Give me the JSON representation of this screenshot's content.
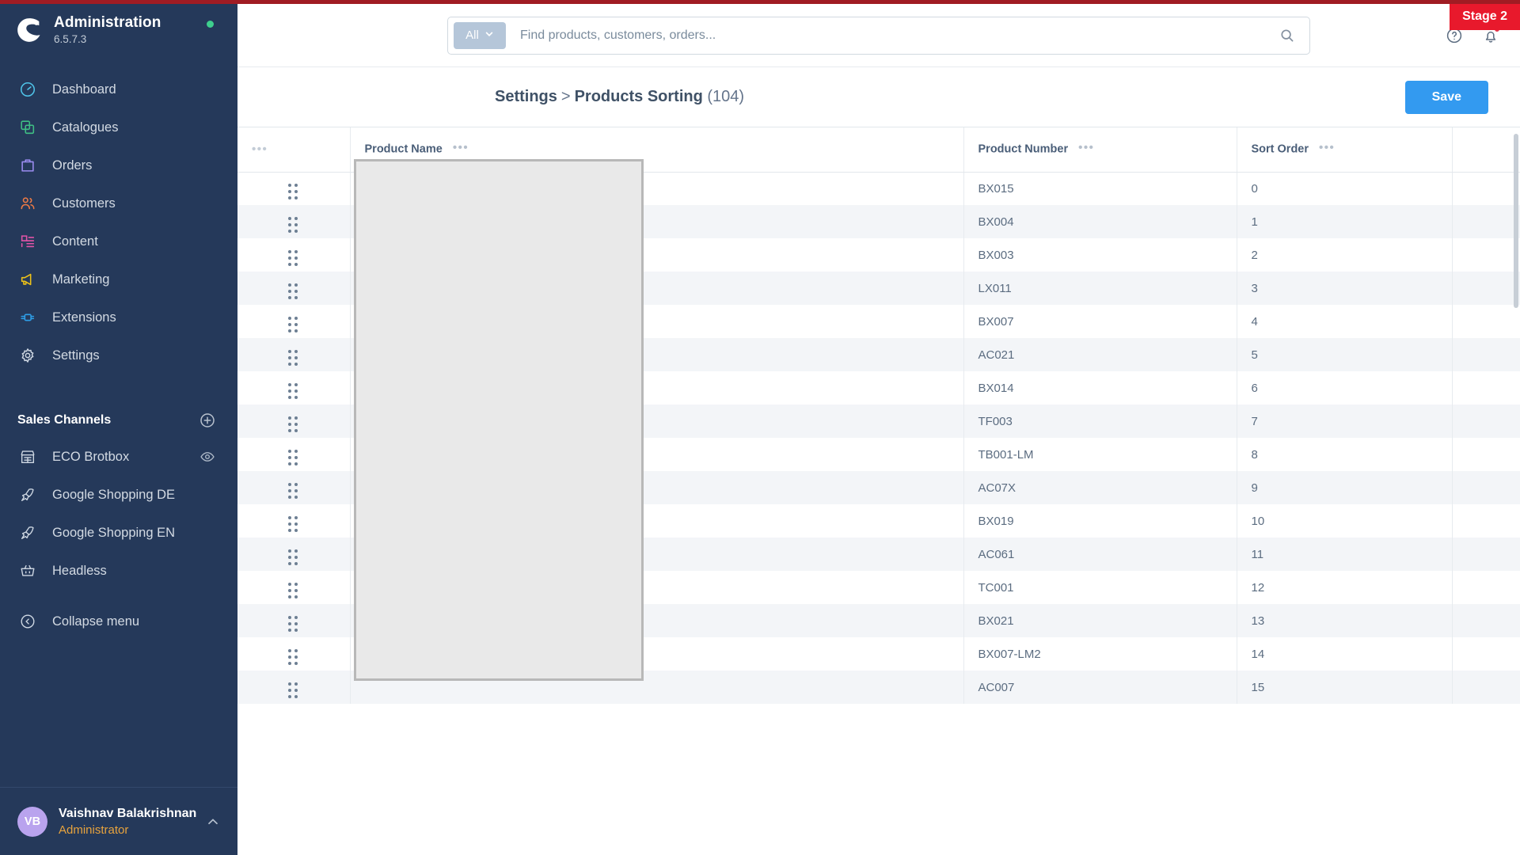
{
  "stage_badge": "Stage 2",
  "sidebar": {
    "brand": {
      "title": "Administration",
      "version": "6.5.7.3"
    },
    "nav": [
      {
        "label": "Dashboard",
        "icon": "dashboard-icon"
      },
      {
        "label": "Catalogues",
        "icon": "catalogues-icon"
      },
      {
        "label": "Orders",
        "icon": "orders-icon"
      },
      {
        "label": "Customers",
        "icon": "customers-icon"
      },
      {
        "label": "Content",
        "icon": "content-icon"
      },
      {
        "label": "Marketing",
        "icon": "marketing-icon"
      },
      {
        "label": "Extensions",
        "icon": "extensions-icon"
      },
      {
        "label": "Settings",
        "icon": "settings-icon"
      }
    ],
    "sales_channels_title": "Sales Channels",
    "sales_channels": [
      {
        "label": "ECO Brotbox",
        "icon": "storefront-icon",
        "has_eye": true
      },
      {
        "label": "Google Shopping DE",
        "icon": "rocket-icon",
        "has_eye": false
      },
      {
        "label": "Google Shopping EN",
        "icon": "rocket-icon",
        "has_eye": false
      },
      {
        "label": "Headless",
        "icon": "basket-icon",
        "has_eye": false
      }
    ],
    "collapse_label": "Collapse menu",
    "user": {
      "initials": "VB",
      "name": "Vaishnav Balakrishnan",
      "role": "Administrator"
    }
  },
  "header": {
    "scope_label": "All",
    "search_placeholder": "Find products, customers, orders...",
    "search_value": ""
  },
  "page": {
    "breadcrumb_root": "Settings",
    "breadcrumb_sep": ">",
    "breadcrumb_current": "Products Sorting",
    "count": "(104)",
    "save_label": "Save"
  },
  "grid": {
    "columns": [
      {
        "key": "handle",
        "label": ""
      },
      {
        "key": "name",
        "label": "Product Name"
      },
      {
        "key": "number",
        "label": "Product Number"
      },
      {
        "key": "sort",
        "label": "Sort Order"
      }
    ],
    "menu_dots": "•••",
    "rows": [
      {
        "number": "BX015",
        "sort": "0"
      },
      {
        "number": "BX004",
        "sort": "1"
      },
      {
        "number": "BX003",
        "sort": "2"
      },
      {
        "number": "LX011",
        "sort": "3"
      },
      {
        "number": "BX007",
        "sort": "4"
      },
      {
        "number": "AC021",
        "sort": "5"
      },
      {
        "number": "BX014",
        "sort": "6"
      },
      {
        "number": "TF003",
        "sort": "7"
      },
      {
        "number": "TB001-LM",
        "sort": "8"
      },
      {
        "number": "AC07X",
        "sort": "9"
      },
      {
        "number": "BX019",
        "sort": "10"
      },
      {
        "number": "AC061",
        "sort": "11"
      },
      {
        "number": "TC001",
        "sort": "12"
      },
      {
        "number": "BX021",
        "sort": "13"
      },
      {
        "number": "BX007-LM2",
        "sort": "14"
      },
      {
        "number": "AC007",
        "sort": "15"
      }
    ]
  },
  "colors": {
    "sidebar_bg": "#25395a",
    "accent_blue": "#339af0",
    "stage_red": "#e8192c",
    "role_orange": "#e8a33d",
    "status_green": "#3ecf8e"
  }
}
